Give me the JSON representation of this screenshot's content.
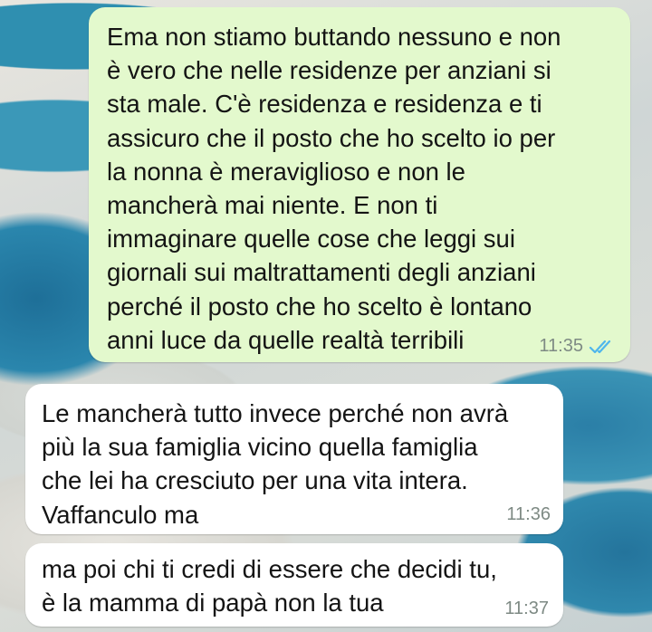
{
  "messages": [
    {
      "direction": "outgoing",
      "text": "Ema non stiamo buttando nessuno e non\nè vero che nelle residenze per anziani si\nsta male. C'è residenza e residenza e ti\nassicuro che il posto che ho scelto io per\nla nonna è meraviglioso e non le\nmancherà mai niente. E non ti\nimmaginare quelle cose che leggi sui\ngiornali sui maltrattamenti degli anziani\nperché il posto che ho scelto è lontano\nanni luce da quelle realtà terribili",
      "time": "11:35",
      "status_icon": "double-check-read-icon"
    },
    {
      "direction": "incoming",
      "text": "Le mancherà tutto invece perché non avrà\npiù la sua famiglia vicino quella famiglia\nche lei ha cresciuto per una vita intera.\nVaffanculo ma",
      "time": "11:36"
    },
    {
      "direction": "incoming",
      "text": "ma poi chi ti credi di essere che decidi tu,\nè la mamma di papà non la tua",
      "time": "11:37"
    }
  ],
  "colors": {
    "outgoing_bubble": "#e3f9cd",
    "incoming_bubble": "#ffffff",
    "timestamp": "#7e8a84",
    "read_ticks": "#4fb6ec"
  }
}
